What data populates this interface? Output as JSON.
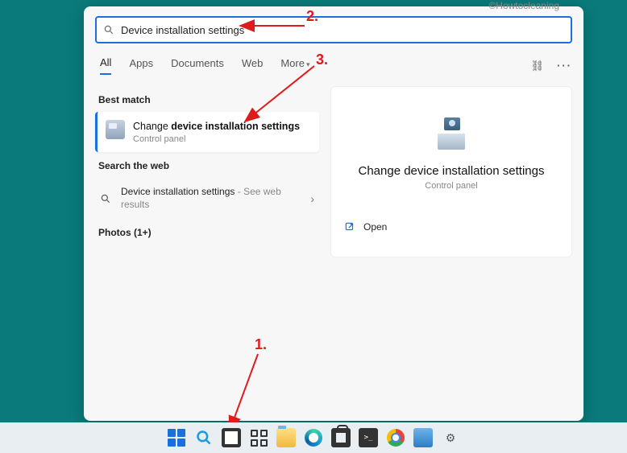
{
  "watermark": "©Howtocleaning",
  "search": {
    "query": "Device installation settings"
  },
  "tabs": {
    "items": [
      "All",
      "Apps",
      "Documents",
      "Web",
      "More"
    ],
    "active_index": 0
  },
  "sections": {
    "best_match_label": "Best match",
    "search_web_label": "Search the web",
    "photos_label": "Photos (1+)"
  },
  "best_match": {
    "title_pre": "Change ",
    "title_bold": "device installation settings",
    "subtitle": "Control panel"
  },
  "web_result": {
    "title": "Device installation settings",
    "suffix": " - See web results"
  },
  "preview": {
    "title": "Change device installation settings",
    "subtitle": "Control panel",
    "open_label": "Open"
  },
  "annotations": {
    "n1": "1.",
    "n2": "2.",
    "n3": "3."
  },
  "taskbar": {
    "cmd_text": ">_"
  }
}
